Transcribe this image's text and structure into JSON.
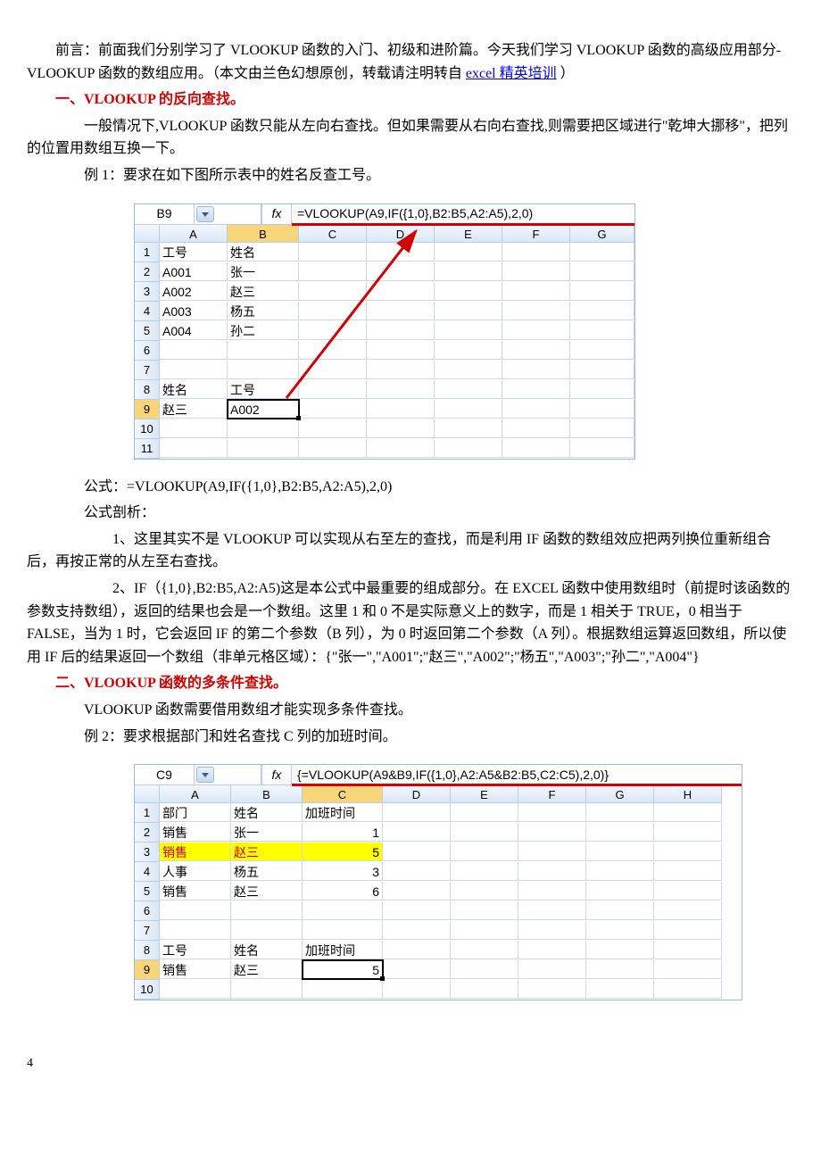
{
  "preface": {
    "p1_a": "前言：前面我们分别学习了 VLOOKUP 函数的入门、初级和进阶篇。今天我们学习 VLOOKUP 函数的高级应用部分-VLOOKUP 函数的数组应用。（本文由兰色幻想原创，转载请注明转自 ",
    "link": "excel 精英培训",
    "p1_b": "）"
  },
  "sec1": {
    "title": "一、VLOOKUP 的反向查找。",
    "p1": "一般情况下,VLOOKUP 函数只能从左向右查找。但如果需要从右向右查找,则需要把区域进行\"乾坤大挪移\"，把列的位置用数组互换一下。",
    "p2": "例 1：要求在如下图所示表中的姓名反查工号。"
  },
  "table1": {
    "namebox": "B9",
    "formula": "=VLOOKUP(A9,IF({1,0},B2:B5,A2:A5),2,0)",
    "cols": [
      "A",
      "B",
      "C",
      "D",
      "E",
      "F",
      "G"
    ],
    "rows": [
      {
        "n": "1",
        "A": "工号",
        "B": "姓名"
      },
      {
        "n": "2",
        "A": "A001",
        "B": "张一"
      },
      {
        "n": "3",
        "A": "A002",
        "B": "赵三"
      },
      {
        "n": "4",
        "A": "A003",
        "B": "杨五"
      },
      {
        "n": "5",
        "A": "A004",
        "B": "孙二"
      },
      {
        "n": "6"
      },
      {
        "n": "7"
      },
      {
        "n": "8",
        "A": "姓名",
        "B": "工号"
      },
      {
        "n": "9",
        "A": "赵三",
        "B": "A002"
      },
      {
        "n": "10"
      },
      {
        "n": "11"
      }
    ]
  },
  "formula_line": "公式：=VLOOKUP(A9,IF({1,0},B2:B5,A2:A5),2,0)",
  "analysis_title": "公式剖析：",
  "analysis1": "1、这里其实不是 VLOOKUP 可以实现从右至左的查找，而是利用 IF 函数的数组效应把两列换位重新组合后，再按正常的从左至右查找。",
  "analysis2": "2、IF（{1,0},B2:B5,A2:A5)这是本公式中最重要的组成部分。在 EXCEL 函数中使用数组时（前提时该函数的参数支持数组），返回的结果也会是一个数组。这里 1 和 0 不是实际意义上的数字，而是 1 相关于 TRUE，0 相当于 FALSE，当为 1 时，它会返回 IF 的第二个参数（B 列），为 0 时返回第二个参数（A 列）。根据数组运算返回数组，所以使用 IF 后的结果返回一个数组（非单元格区域）：{\"张一\",\"A001\";\"赵三\",\"A002\";\"杨五\",\"A003\";\"孙二\",\"A004\"}",
  "sec2": {
    "title": "二、VLOOKUP 函数的多条件查找。",
    "p1": "VLOOKUP 函数需要借用数组才能实现多条件查找。",
    "p2": "例 2：要求根据部门和姓名查找 C 列的加班时间。"
  },
  "table2": {
    "namebox": "C9",
    "formula": "{=VLOOKUP(A9&B9,IF({1,0},A2:A5&B2:B5,C2:C5),2,0)}",
    "cols": [
      "A",
      "B",
      "C",
      "D",
      "E",
      "F",
      "G",
      "H"
    ],
    "rows": [
      {
        "n": "1",
        "A": "部门",
        "B": "姓名",
        "C": "加班时间"
      },
      {
        "n": "2",
        "A": "销售",
        "B": "张一",
        "C": "1"
      },
      {
        "n": "3",
        "A": "销售",
        "B": "赵三",
        "C": "5",
        "hl": true
      },
      {
        "n": "4",
        "A": "人事",
        "B": "杨五",
        "C": "3"
      },
      {
        "n": "5",
        "A": "销售",
        "B": "赵三",
        "C": "6"
      },
      {
        "n": "6"
      },
      {
        "n": "7"
      },
      {
        "n": "8",
        "A": "工号",
        "B": "姓名",
        "C": "加班时间"
      },
      {
        "n": "9",
        "A": "销售",
        "B": "赵三",
        "C": "5"
      },
      {
        "n": "10"
      }
    ]
  },
  "page_number": "4"
}
